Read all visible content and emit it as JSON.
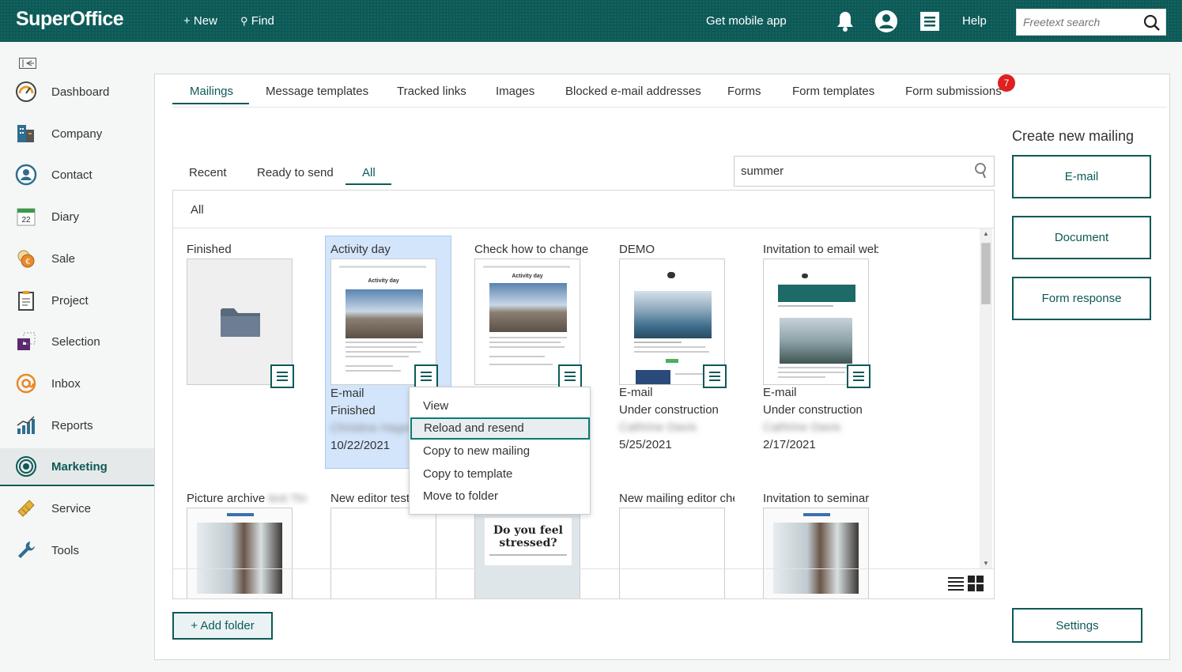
{
  "topbar": {
    "logo": "SuperOffice",
    "new_label": "+ New",
    "find_label": "Find",
    "mobile_label": "Get mobile app",
    "help_label": "Help",
    "search_placeholder": "Freetext search"
  },
  "sidebar": {
    "items": [
      {
        "label": "Dashboard",
        "icon": "dashboard-icon"
      },
      {
        "label": "Company",
        "icon": "company-icon"
      },
      {
        "label": "Contact",
        "icon": "contact-icon"
      },
      {
        "label": "Diary",
        "icon": "diary-icon",
        "icon_text": "22"
      },
      {
        "label": "Sale",
        "icon": "sale-icon"
      },
      {
        "label": "Project",
        "icon": "project-icon"
      },
      {
        "label": "Selection",
        "icon": "selection-icon"
      },
      {
        "label": "Inbox",
        "icon": "inbox-icon"
      },
      {
        "label": "Reports",
        "icon": "reports-icon"
      },
      {
        "label": "Marketing",
        "icon": "marketing-icon",
        "active": true
      },
      {
        "label": "Service",
        "icon": "service-icon"
      },
      {
        "label": "Tools",
        "icon": "tools-icon"
      }
    ]
  },
  "tabs": [
    "Mailings",
    "Message templates",
    "Tracked links",
    "Images",
    "Blocked e-mail addresses",
    "Forms",
    "Form templates",
    "Form submissions"
  ],
  "badge_count": "7",
  "subtabs": [
    "Recent",
    "Ready to send",
    "All"
  ],
  "filter_value": "summer",
  "grid_header": "All",
  "cards": [
    {
      "title": "Finished",
      "type": "",
      "status": "",
      "owner": "",
      "date": ""
    },
    {
      "title": "Activity day",
      "type": "E-mail",
      "status": "Finished",
      "owner": "Christine Hagen",
      "date": "10/22/2021",
      "thumb_heading": "Activity day"
    },
    {
      "title": "Check how to change i",
      "type": "",
      "status": "",
      "owner": "",
      "date": "",
      "thumb_heading": "Activity day"
    },
    {
      "title": "DEMO",
      "type": "E-mail",
      "status": "Under construction",
      "owner": "Cathrine Davis",
      "date": "5/25/2021"
    },
    {
      "title": "Invitation to email web",
      "type": "E-mail",
      "status": "Under construction",
      "owner": "Cathrine Davis",
      "date": "2/17/2021"
    },
    {
      "title": "Picture archive",
      "title_blur": "test Tin",
      "type": "",
      "status": "",
      "owner": "",
      "date": ""
    },
    {
      "title": "New editor test",
      "type": "",
      "status": "",
      "owner": "",
      "date": ""
    },
    {
      "title": "",
      "type": "",
      "status": "",
      "owner": "",
      "date": "",
      "thumb_heading": "Do you feel stressed?"
    },
    {
      "title": "New mailing editor che",
      "type": "",
      "status": "",
      "owner": "",
      "date": ""
    },
    {
      "title": "Invitation to seminar",
      "type": "",
      "status": "",
      "owner": "",
      "date": ""
    }
  ],
  "context_menu": [
    "View",
    "Reload and resend",
    "Copy to new mailing",
    "Copy to template",
    "Move to folder"
  ],
  "right_panel": {
    "title": "Create new mailing",
    "buttons": [
      "E-mail",
      "Document",
      "Form response"
    ],
    "settings_label": "Settings"
  },
  "add_folder_label": "+ Add folder",
  "colors": {
    "brand": "#0c5a57",
    "badge": "#e02020",
    "selected": "#d3e5fb"
  }
}
